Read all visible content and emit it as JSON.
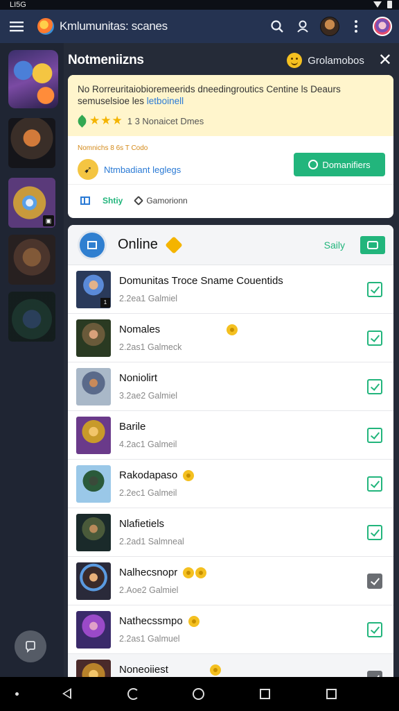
{
  "status_bar": {
    "time": "LI5G"
  },
  "app_bar": {
    "title": "Kmlumunitas: scanes",
    "icons": [
      "menu-icon",
      "search-icon",
      "person-icon",
      "overflow-icon"
    ]
  },
  "panel": {
    "title": "Notmeniizns",
    "tag": "Grolamobos",
    "notice": {
      "text": "No Rorreuritaiobioremeerids dneedingroutics Centine ls Deaurs semuselsioe les ",
      "link": "letboinell",
      "rating_text": "1 3 Nonaicet Dmes",
      "stars": "★★★"
    },
    "info": {
      "caption": "Nomnichs 8 6s T Codo",
      "meta_link": "Ntmbadiant leglegs",
      "primary_button": "Domanifiers",
      "action_green": "Shtiy",
      "action_gray": "Gamorionn"
    }
  },
  "list": {
    "title": "Online",
    "right_label": "Saily",
    "rows": [
      {
        "name": "Domunitas Troce Sname Couentids",
        "sub": "2.2ea1 Galmiel",
        "badge": "1"
      },
      {
        "name": "Nomales",
        "sub": "2.2as1 Galmeck"
      },
      {
        "name": "Noniolirt",
        "sub": "3.2ae2 Galmiel"
      },
      {
        "name": "Barile",
        "sub": "4.2ac1 Galmeil"
      },
      {
        "name": "Rakodapaso",
        "sub": "2.2ec1 Galmeil"
      },
      {
        "name": "Nlafietiels",
        "sub": "2.2ad1 Salmneal"
      },
      {
        "name": "Nalhecsnopr",
        "sub": "2.Aoe2 Galmiel"
      },
      {
        "name": "Nathecssmpo",
        "sub": "2.2as1 Galmuel"
      },
      {
        "name": "Noneoiiest",
        "sub": ""
      }
    ]
  },
  "colors": {
    "app_bar": "#253351",
    "accent_green": "#22b57c",
    "link_blue": "#2a7ad5",
    "notice_bg": "#fff5cc"
  }
}
